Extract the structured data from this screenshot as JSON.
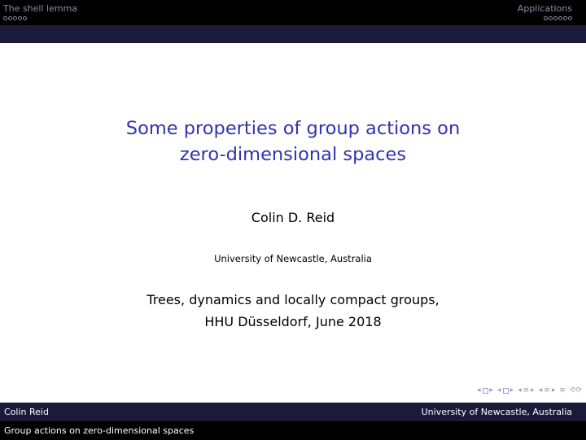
{
  "nav": {
    "left_section": "The shell lemma",
    "left_dots": 5,
    "right_section": "Applications",
    "right_dots": 6
  },
  "title_line1": "Some properties of group actions on",
  "title_line2": "zero-dimensional spaces",
  "author": "Colin D. Reid",
  "institute": "University of Newcastle, Australia",
  "date_line1": "Trees, dynamics and locally compact groups,",
  "date_line2": "HHU Düsseldorf, June 2018",
  "footer": {
    "author": "Colin Reid",
    "institute": "University of Newcastle, Australia",
    "short_title": "Group actions on zero-dimensional spaces"
  },
  "colors": {
    "title": "#3333b2",
    "header_bg": "#000000",
    "footer_bg": "#1a1a3a"
  }
}
